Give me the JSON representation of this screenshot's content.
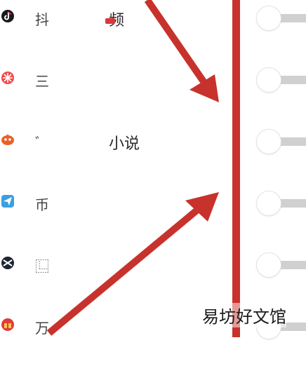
{
  "apps": [
    {
      "icon": "tiktok-icon",
      "label": "抖",
      "label2": "频",
      "toggle_on": false
    },
    {
      "icon": "red-star-app-icon",
      "label": "三",
      "label2": "",
      "toggle_on": false
    },
    {
      "icon": "orange-app-icon",
      "label": "ﾞ",
      "label2": "小说",
      "toggle_on": false
    },
    {
      "icon": "paper-plane-icon",
      "label": "币",
      "label2": "",
      "toggle_on": false
    },
    {
      "icon": "cross-circle-icon",
      "label": "⿺",
      "label2": "",
      "toggle_on": false
    },
    {
      "icon": "red-gift-app-icon",
      "label": "万",
      "label2": "",
      "toggle_on": false
    }
  ],
  "colors": {
    "annotation_red": "#c8322c",
    "toggle_track": "#d0d0d0"
  },
  "watermark": "易坊好文馆"
}
